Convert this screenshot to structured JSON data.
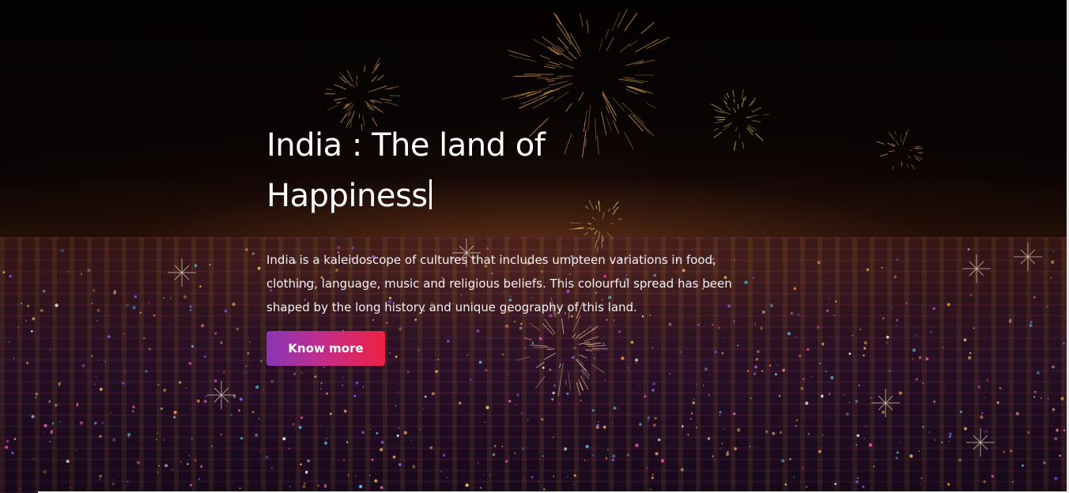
{
  "hero": {
    "title_line1": "India : The land of",
    "title_line2": "Happiness",
    "description": "India is a kaleidoscope of cultures that includes umpteen variations in food, clothing, language, music and religious beliefs. This colourful spread has been shaped by the long history and unique geography of this land.",
    "button_label": "Know more"
  },
  "colors": {
    "button_gradient_start": "#8a35b5",
    "button_gradient_end": "#ee2142",
    "text": "#ffffff"
  },
  "background": {
    "scene": "night-city-fireworks-image"
  }
}
